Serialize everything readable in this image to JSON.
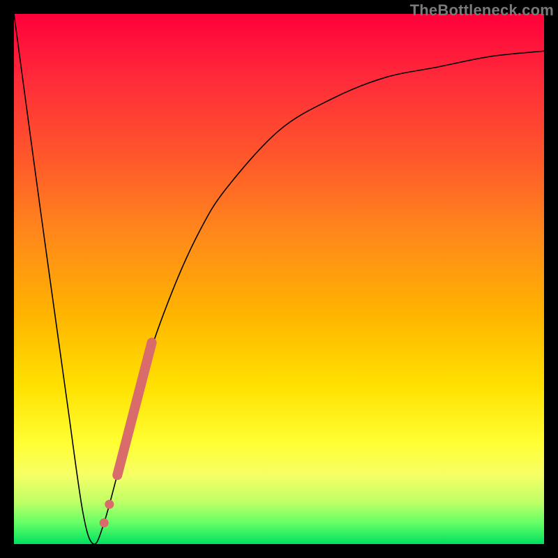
{
  "watermark": "TheBottleneck.com",
  "colors": {
    "curve": "#000000",
    "marker": "#d96b6b"
  },
  "chart_data": {
    "type": "line",
    "title": "",
    "xlabel": "",
    "ylabel": "",
    "xlim": [
      0,
      100
    ],
    "ylim": [
      0,
      100
    ],
    "grid": false,
    "series": [
      {
        "name": "bottleneck-curve",
        "x": [
          0,
          5,
          10,
          13,
          15,
          17,
          20,
          25,
          30,
          35,
          40,
          50,
          60,
          70,
          80,
          90,
          100
        ],
        "values": [
          100,
          63,
          27,
          6,
          0,
          4,
          15,
          34,
          48,
          59,
          67,
          78,
          84,
          88,
          90,
          92,
          93
        ]
      }
    ],
    "markers": {
      "name": "highlight-dots",
      "segment_start": {
        "x": 19.5,
        "y": 13
      },
      "segment_end": {
        "x": 26,
        "y": 38
      },
      "extra_dots": [
        {
          "x": 17.0,
          "y": 4.0
        },
        {
          "x": 18.0,
          "y": 7.5
        }
      ]
    }
  }
}
